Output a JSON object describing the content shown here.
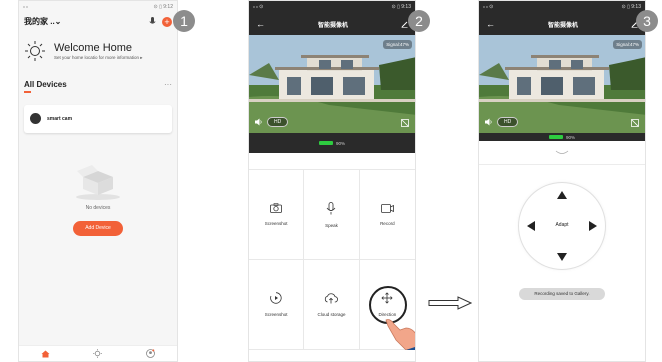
{
  "steps": [
    "1",
    "2",
    "3"
  ],
  "phone1": {
    "status_left": "ₗₗ ₗₗ",
    "status_right": "⊙ ▯ 9:12",
    "home_title": "我的家 ..⌄",
    "welcome_title": "Welcome Home",
    "welcome_sub": "Set your home locatio for more information ▸",
    "all_devices": "All Devices",
    "more": "···",
    "device_name": "smart cam",
    "no_device": "No devices",
    "add_device": "Add Device",
    "accent": "#f26138"
  },
  "camera": {
    "title": "智能摄像机",
    "status_left": "ₗₗ ₗₗ ⊙",
    "status_right": "⊙ ▯ 9:13",
    "signal": "Signal:47%",
    "hd": "HD",
    "battery": "90%",
    "actions": [
      {
        "label": "Screenshot",
        "icon": "camera-icon"
      },
      {
        "label": "Speak",
        "icon": "microphone-icon"
      },
      {
        "label": "Record",
        "icon": "video-icon"
      },
      {
        "label": "Screenshot",
        "icon": "playback-icon"
      },
      {
        "label": "Cloud storage",
        "icon": "cloud-icon"
      },
      {
        "label": "Direction",
        "icon": "move-icon"
      }
    ],
    "adapt": "Adapt",
    "toast": "Recording saved to Gallery."
  }
}
